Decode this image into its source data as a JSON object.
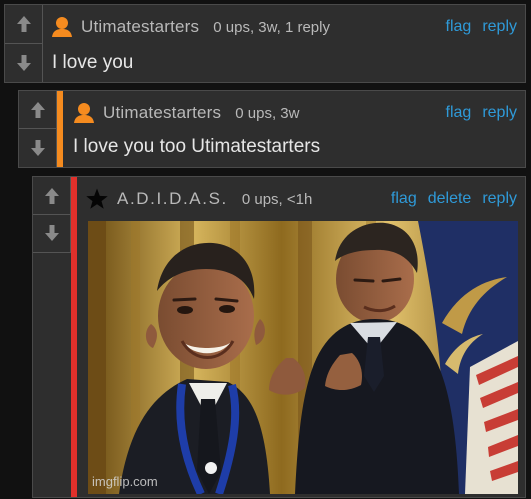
{
  "comments": [
    {
      "username": "Utimatestarters",
      "meta": "0 ups, 3w, 1 reply",
      "actions": {
        "flag": "flag",
        "reply": "reply"
      },
      "text": "I love you"
    },
    {
      "username": "Utimatestarters",
      "meta": "0 ups, 3w",
      "actions": {
        "flag": "flag",
        "reply": "reply"
      },
      "text": "I love you too Utimatestarters"
    },
    {
      "username": "A.D.I.D.A.S.",
      "meta": "0 ups, <1h",
      "actions": {
        "flag": "flag",
        "delete": "delete",
        "reply": "reply"
      }
    }
  ],
  "watermark": "imgflip.com",
  "colors": {
    "background": "#111111",
    "card": "#2e2e2e",
    "border": "#4a4a4a",
    "link": "#2f9ad8",
    "meta": "#b9b9b9",
    "accent_orange": "#f58b1f",
    "accent_red": "#e0302b"
  },
  "icons": {
    "upvote": "arrow-up-icon",
    "downvote": "arrow-down-icon",
    "avatar": "user-icon",
    "star": "star-icon"
  }
}
